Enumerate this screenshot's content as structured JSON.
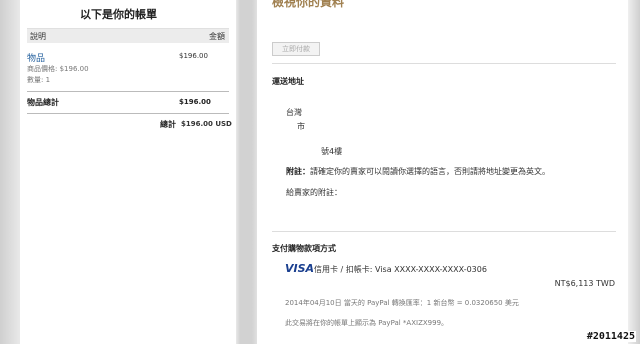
{
  "cart": {
    "title": "以下是你的帳單",
    "col_desc": "說明",
    "col_amount": "金額",
    "item": {
      "name": "物品",
      "price_line": "商品價格: $196.00",
      "qty_line": "數量: 1",
      "amount": "$196.00"
    },
    "subtotal_label": "物品總計",
    "subtotal_value": "$196.00",
    "total_label": "總計",
    "total_value": "$196.00 USD"
  },
  "review": {
    "title": "檢視你的資料",
    "pay_now_label": "立即付款",
    "shipping": {
      "heading": "運送地址",
      "line1": "台灣",
      "line2": "市",
      "line3": "　　　號4樓"
    },
    "note_label": "附註：",
    "note_text": "請確定你的賣家可以閱讀你選擇的語言，否則請將地址變更為英文。",
    "seller_note_label": "給賣家的附註：",
    "payment": {
      "heading": "支付購物款項方式",
      "card_brand": "VISA",
      "card_line": "信用卡 / 扣帳卡: Visa XXXX-XXXX-XXXX-0306",
      "amount": "NT$6,113 TWD",
      "rate_line": "2014年04月10日 當天的 PayPal 轉換匯率：1 新台幣 = 0.0320650 美元",
      "statement_line": "此交易將在你的帳單上顯示為 PayPal *AXIZX999。"
    }
  },
  "watermark": "#2011425"
}
